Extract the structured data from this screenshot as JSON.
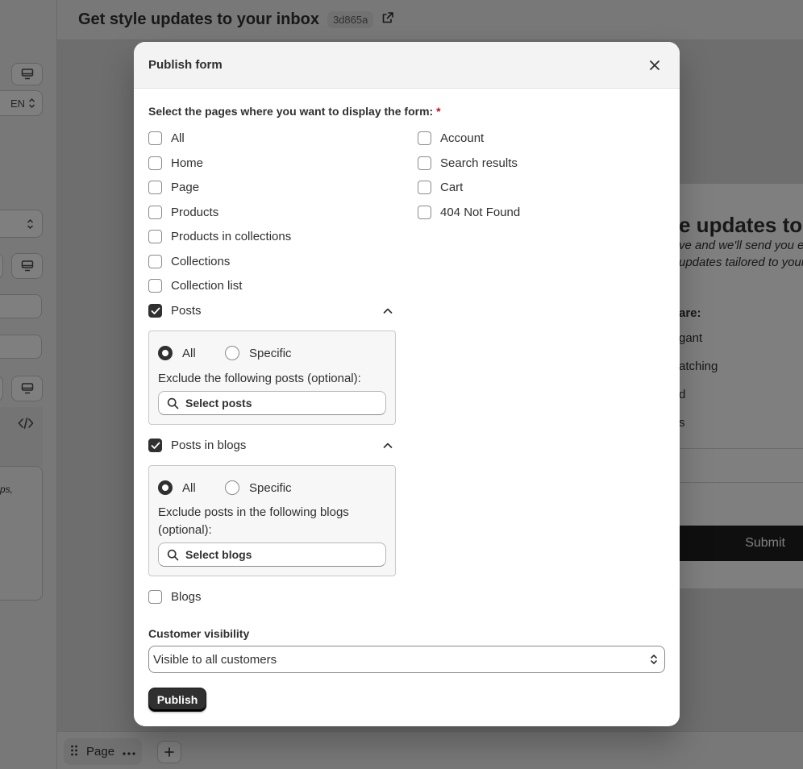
{
  "app": {
    "page_title": "Get style updates to your inbox",
    "form_id": "3d865a",
    "language": "EN",
    "page_tab_label": "Page",
    "preview": {
      "heading_fragment": "e updates to",
      "subtitle_line1": "ve and we'll send you e",
      "subtitle_line2": "updates tailored to your",
      "question_fragment": "are:",
      "options": [
        "gant",
        "atching",
        "d",
        "s"
      ],
      "submit_label": "Submit",
      "side_text": "ps,"
    }
  },
  "modal": {
    "title": "Publish form",
    "pages_label": "Select the pages where you want to display the form:",
    "required_mark": "*",
    "left_pages": [
      {
        "label": "All",
        "checked": false
      },
      {
        "label": "Home",
        "checked": false
      },
      {
        "label": "Page",
        "checked": false
      },
      {
        "label": "Products",
        "checked": false
      },
      {
        "label": "Products in collections",
        "checked": false
      },
      {
        "label": "Collections",
        "checked": false
      },
      {
        "label": "Collection list",
        "checked": false
      }
    ],
    "right_pages": [
      {
        "label": "Account",
        "checked": false
      },
      {
        "label": "Search results",
        "checked": false
      },
      {
        "label": "Cart",
        "checked": false
      },
      {
        "label": "404 Not Found",
        "checked": false
      }
    ],
    "posts": {
      "label": "Posts",
      "checked": true,
      "radio_all": "All",
      "radio_specific": "Specific",
      "selected": "All",
      "exclude_text": "Exclude the following posts (optional):",
      "search_label": "Select posts"
    },
    "posts_in_blogs": {
      "label": "Posts in blogs",
      "checked": true,
      "radio_all": "All",
      "radio_specific": "Specific",
      "selected": "All",
      "exclude_text": "Exclude posts in the following blogs (optional):",
      "search_label": "Select blogs"
    },
    "blogs": {
      "label": "Blogs",
      "checked": false
    },
    "visibility_label": "Customer visibility",
    "visibility_value": "Visible to all customers",
    "publish_label": "Publish"
  },
  "colors": {
    "primary": "#303030",
    "required": "#c70a24",
    "overlay": "rgba(0,0,0,0.5)"
  }
}
